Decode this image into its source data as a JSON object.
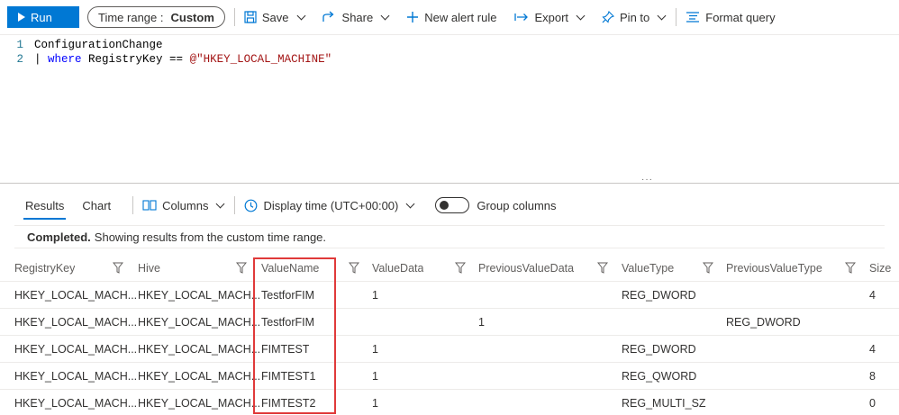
{
  "toolbar": {
    "run_label": "Run",
    "time_range_label": "Time range :",
    "time_range_value": "Custom",
    "save_label": "Save",
    "share_label": "Share",
    "new_alert_label": "New alert rule",
    "export_label": "Export",
    "pin_label": "Pin to",
    "format_label": "Format query"
  },
  "editor": {
    "lines": [
      {
        "number": "1",
        "text": "ConfigurationChange"
      },
      {
        "number": "2",
        "pipe": "| ",
        "keyword": "where",
        "mid": " RegistryKey == ",
        "string": "@\"HKEY_LOCAL_MACHINE\""
      }
    ],
    "resize_handle": "···"
  },
  "results": {
    "tabs": [
      "Results",
      "Chart"
    ],
    "active_tab": "Results",
    "columns_label": "Columns",
    "display_time_label": "Display time (UTC+00:00)",
    "group_columns_label": "Group columns",
    "status_bold": "Completed.",
    "status_text": "Showing results from the custom time range."
  },
  "table": {
    "headers": [
      "RegistryKey",
      "Hive",
      "ValueName",
      "ValueData",
      "PreviousValueData",
      "ValueType",
      "PreviousValueType",
      "Size"
    ],
    "rows": [
      [
        "HKEY_LOCAL_MACH...",
        "HKEY_LOCAL_MACH...",
        "TestforFIM",
        "1",
        "",
        "REG_DWORD",
        "",
        "4"
      ],
      [
        "HKEY_LOCAL_MACH...",
        "HKEY_LOCAL_MACH...",
        "TestforFIM",
        "",
        "1",
        "",
        "REG_DWORD",
        ""
      ],
      [
        "HKEY_LOCAL_MACH...",
        "HKEY_LOCAL_MACH...",
        "FIMTEST",
        "1",
        "",
        "REG_DWORD",
        "",
        "4"
      ],
      [
        "HKEY_LOCAL_MACH...",
        "HKEY_LOCAL_MACH...",
        "FIMTEST1",
        "1",
        "",
        "REG_QWORD",
        "",
        "8"
      ],
      [
        "HKEY_LOCAL_MACH...",
        "HKEY_LOCAL_MACH...",
        "FIMTEST2",
        "1",
        "",
        "REG_MULTI_SZ",
        "",
        "0"
      ]
    ]
  },
  "colors": {
    "accent": "#0078d4",
    "highlight": "#e03a3a"
  },
  "icons": [
    "play-icon",
    "save-icon",
    "share-icon",
    "plus-icon",
    "export-icon",
    "pin-icon",
    "format-icon",
    "columns-icon",
    "clock-icon",
    "filter-icon"
  ]
}
